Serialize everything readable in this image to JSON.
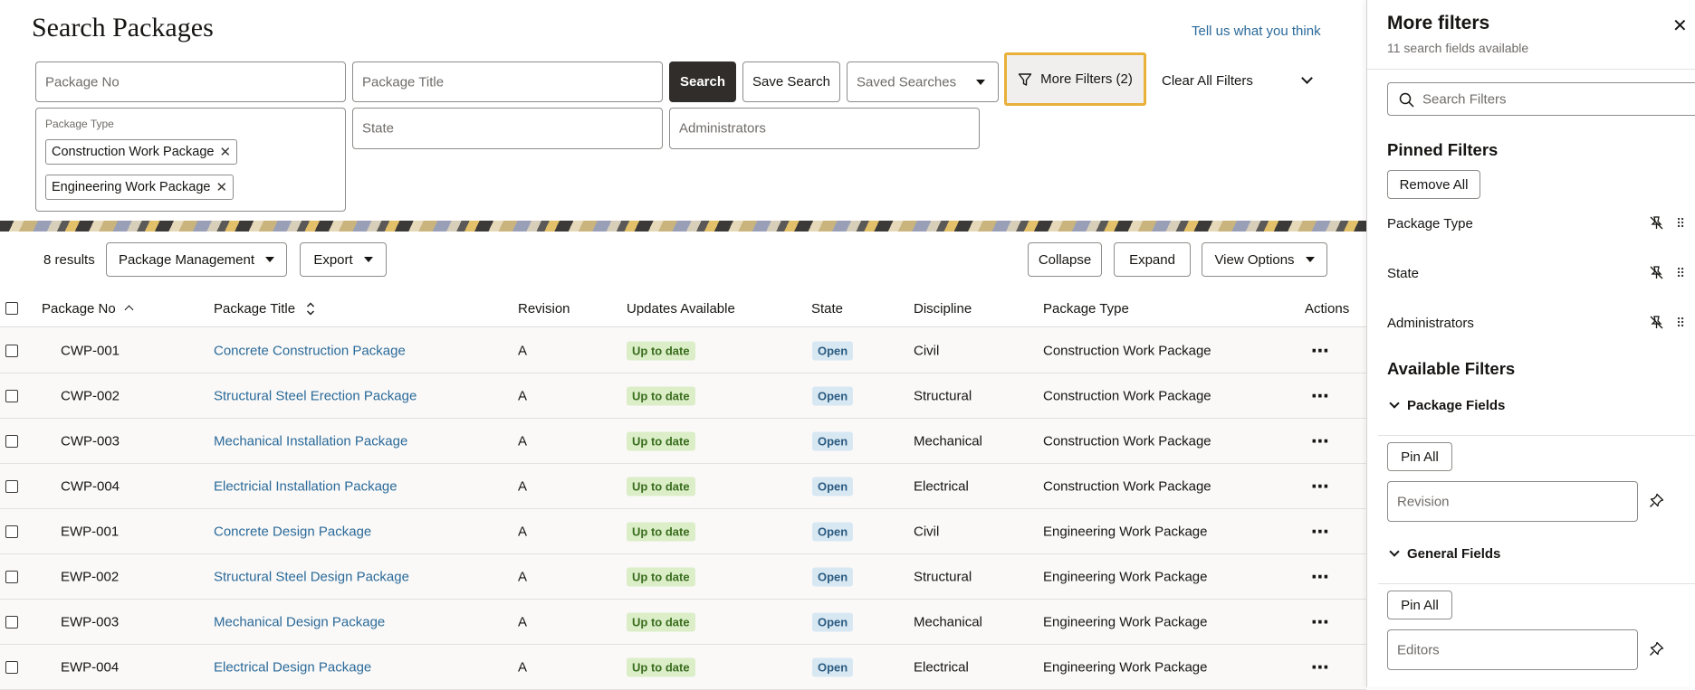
{
  "header": {
    "title": "Search Packages",
    "feedback_link": "Tell us what you think"
  },
  "filters": {
    "package_no_placeholder": "Package No",
    "package_title_placeholder": "Package Title",
    "search_button": "Search",
    "save_search_button": "Save Search",
    "saved_searches_placeholder": "Saved Searches",
    "more_filters_button": "More Filters (2)",
    "clear_all_button": "Clear All Filters",
    "package_type_label": "Package Type",
    "package_type_chips": [
      "Construction Work Package",
      "Engineering Work Package"
    ],
    "state_placeholder": "State",
    "administrators_placeholder": "Administrators"
  },
  "toolbar": {
    "results": "8 results",
    "package_management": "Package Management",
    "export": "Export",
    "collapse": "Collapse",
    "expand": "Expand",
    "view_options": "View Options"
  },
  "table": {
    "columns": [
      "Package No",
      "Package Title",
      "Revision",
      "Updates Available",
      "State",
      "Discipline",
      "Package Type",
      "Actions"
    ],
    "rows": [
      {
        "no": "CWP-001",
        "title": "Concrete Construction Package",
        "revision": "A",
        "updates": "Up to date",
        "state": "Open",
        "discipline": "Civil",
        "type": "Construction Work Package"
      },
      {
        "no": "CWP-002",
        "title": "Structural Steel Erection Package",
        "revision": "A",
        "updates": "Up to date",
        "state": "Open",
        "discipline": "Structural",
        "type": "Construction Work Package"
      },
      {
        "no": "CWP-003",
        "title": "Mechanical Installation Package",
        "revision": "A",
        "updates": "Up to date",
        "state": "Open",
        "discipline": "Mechanical",
        "type": "Construction Work Package"
      },
      {
        "no": "CWP-004",
        "title": "Electricial Installation Package",
        "revision": "A",
        "updates": "Up to date",
        "state": "Open",
        "discipline": "Electrical",
        "type": "Construction Work Package"
      },
      {
        "no": "EWP-001",
        "title": "Concrete Design Package",
        "revision": "A",
        "updates": "Up to date",
        "state": "Open",
        "discipline": "Civil",
        "type": "Engineering Work Package"
      },
      {
        "no": "EWP-002",
        "title": "Structural Steel Design Package",
        "revision": "A",
        "updates": "Up to date",
        "state": "Open",
        "discipline": "Structural",
        "type": "Engineering Work Package"
      },
      {
        "no": "EWP-003",
        "title": "Mechanical Design Package",
        "revision": "A",
        "updates": "Up to date",
        "state": "Open",
        "discipline": "Mechanical",
        "type": "Engineering Work Package"
      },
      {
        "no": "EWP-004",
        "title": "Electrical Design Package",
        "revision": "A",
        "updates": "Up to date",
        "state": "Open",
        "discipline": "Electrical",
        "type": "Engineering Work Package"
      }
    ]
  },
  "panel": {
    "title": "More filters",
    "subtitle": "11 search fields available",
    "search_placeholder": "Search Filters",
    "pinned_heading": "Pinned Filters",
    "remove_all": "Remove All",
    "pinned": [
      "Package Type",
      "State",
      "Administrators"
    ],
    "available_heading": "Available Filters",
    "package_fields_heading": "Package Fields",
    "general_fields_heading": "General Fields",
    "pin_all": "Pin All",
    "revision_placeholder": "Revision",
    "editors_placeholder": "Editors"
  }
}
